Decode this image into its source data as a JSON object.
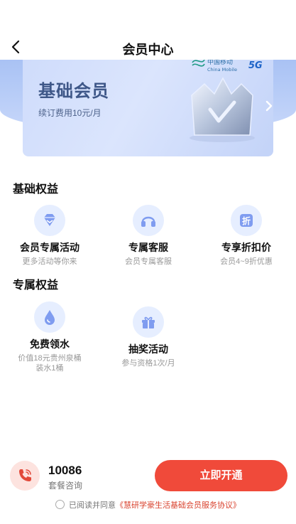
{
  "header": {
    "title": "会员中心"
  },
  "card": {
    "title": "基础会员",
    "subtitle": "续订费用10元/月",
    "brand_cn": "中国移动",
    "brand_en": "China Mobile",
    "brand_5g": "5G"
  },
  "basic_section": {
    "title": "基础权益",
    "items": [
      {
        "icon": "diamond-icon",
        "name": "会员专属活动",
        "desc": "更多活动等你来"
      },
      {
        "icon": "headset-icon",
        "name": "专属客服",
        "desc": "会员专属客服"
      },
      {
        "icon": "discount-tag-icon",
        "name": "专享折扣价",
        "desc": "会员4~9折优惠"
      }
    ]
  },
  "exclusive_section": {
    "title": "专属权益",
    "items": [
      {
        "icon": "water-drop-icon",
        "name": "免费领水",
        "desc": "价值18元贵州泉桶装水1桶"
      },
      {
        "icon": "gift-icon",
        "name": "抽奖活动",
        "desc": "参与资格1次/月"
      }
    ]
  },
  "bottom": {
    "hotline": "10086",
    "hotline_label": "套餐咨询",
    "open_button": "立即开通",
    "agree_prefix": "已阅读并同意",
    "agree_link": "《慧研学豪生活基础会员服务协议》"
  },
  "colors": {
    "accent": "#f04a3a",
    "card_text": "#3e5788",
    "icon_bg": "#e6eeff",
    "icon_fg": "#7f9cf0"
  }
}
